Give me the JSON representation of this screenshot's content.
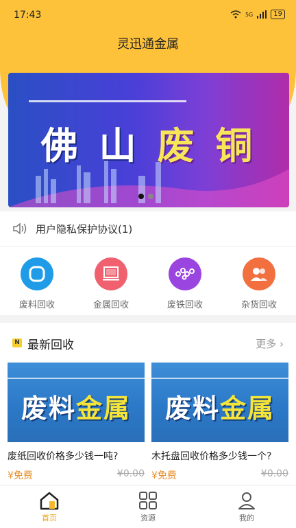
{
  "status_bar": {
    "time": "17:43",
    "network": "5G",
    "battery": "19"
  },
  "app": {
    "title": "灵迅通金属"
  },
  "banner": {
    "text_white": "佛 山 ",
    "text_yellow": "废 铜",
    "slide_count": 2,
    "active_slide": 1
  },
  "notice": {
    "text": "用户隐私保护协议(1)",
    "icon": "speaker-icon"
  },
  "categories": [
    {
      "label": "废料回收",
      "icon": "ring-icon",
      "color": "#1f9be8"
    },
    {
      "label": "金属回收",
      "icon": "monitor-icon",
      "color": "#f0606e"
    },
    {
      "label": "废铁回收",
      "icon": "link-icon",
      "color": "#9b45e0"
    },
    {
      "label": "杂货回收",
      "icon": "people-icon",
      "color": "#f27040"
    }
  ],
  "latest": {
    "title": "最新回收",
    "badge": "N",
    "more": "更多",
    "items": [
      {
        "img_text_white": "废料",
        "img_text_yellow": "金属",
        "title": "废纸回收价格多少钱一吨?",
        "price": "¥免费",
        "original_price": "¥0.00"
      },
      {
        "img_text_white": "废料",
        "img_text_yellow": "金属",
        "title": "木托盘回收价格多少钱一个?",
        "price": "¥免费",
        "original_price": "¥0.00"
      }
    ]
  },
  "tabbar": [
    {
      "label": "首页",
      "icon": "home-icon",
      "active": true
    },
    {
      "label": "资源",
      "icon": "grid-icon",
      "active": false
    },
    {
      "label": "我的",
      "icon": "user-icon",
      "active": false
    }
  ],
  "colors": {
    "accent": "#fdc23a",
    "active_tab": "#e9a61c",
    "price": "#e8902a"
  }
}
